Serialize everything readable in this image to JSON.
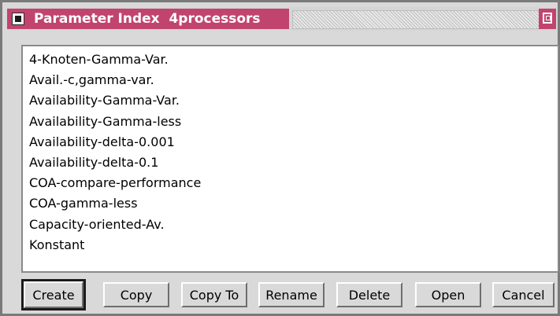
{
  "window": {
    "title": "Parameter Index  4processors"
  },
  "list": {
    "items": [
      "4-Knoten-Gamma-Var.",
      "Avail.-c,gamma-var.",
      "Availability-Gamma-Var.",
      "Availability-Gamma-less",
      "Availability-delta-0.001",
      "Availability-delta-0.1",
      "COA-compare-performance",
      "COA-gamma-less",
      "Capacity-oriented-Av.",
      "Konstant"
    ]
  },
  "buttons": {
    "create": "Create",
    "copy": "Copy",
    "copy_to": "Copy To",
    "rename": "Rename",
    "delete": "Delete",
    "open": "Open",
    "cancel": "Cancel"
  },
  "colors": {
    "title_bar": "#c1446f",
    "window_bg": "#d9d9d9",
    "list_bg": "#ffffff"
  }
}
